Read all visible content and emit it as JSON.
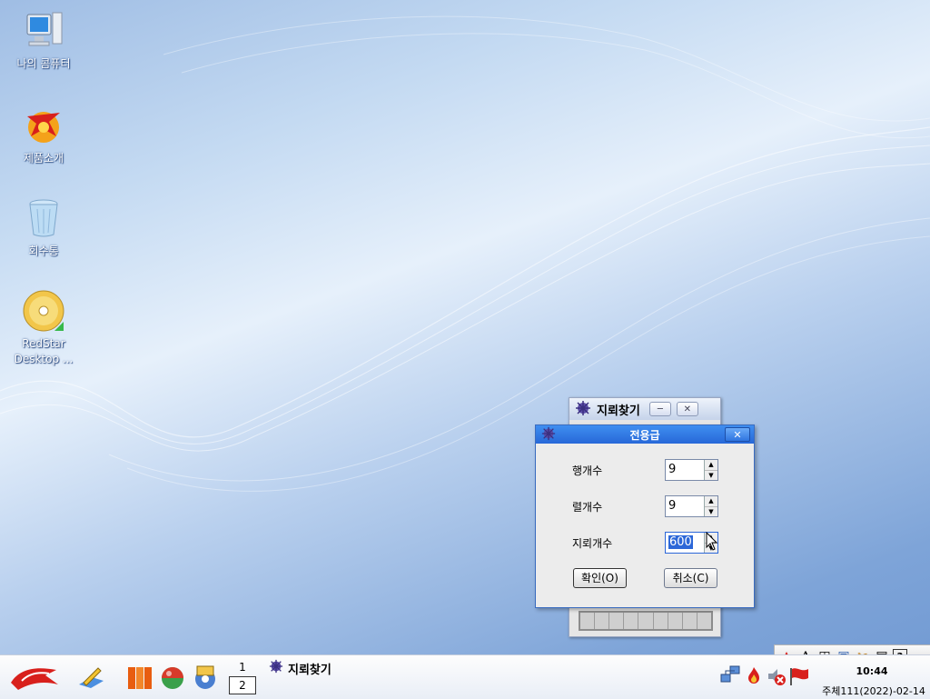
{
  "desktop": {
    "icons": [
      {
        "label": "나의 콤퓨터"
      },
      {
        "label": "제품소개"
      },
      {
        "label": "회수통"
      },
      {
        "label": "RedStar Desktop ..."
      }
    ]
  },
  "bg_window": {
    "title": "지뢰찾기"
  },
  "dialog": {
    "title": "전용급",
    "fields": [
      {
        "label": "행개수",
        "value": "9"
      },
      {
        "label": "렬개수",
        "value": "9"
      },
      {
        "label": "지뢰개수",
        "value": "600"
      }
    ],
    "ok_label": "확인(O)",
    "cancel_label": "취소(C)"
  },
  "taskbar": {
    "pager": {
      "page1": "1",
      "page2": "2"
    },
    "task_title": "지뢰찾기",
    "clock": "10:44",
    "date": "주체111(2022)-02-14"
  },
  "ime_bar": {
    "icons": [
      "flame-icon",
      "font-icon",
      "layout-icon",
      "note-icon",
      "tools-icon",
      "clipboard-icon",
      "help-icon"
    ]
  },
  "colors": {
    "titlebar": "#2f75e0",
    "selection": "#2c67d8"
  }
}
